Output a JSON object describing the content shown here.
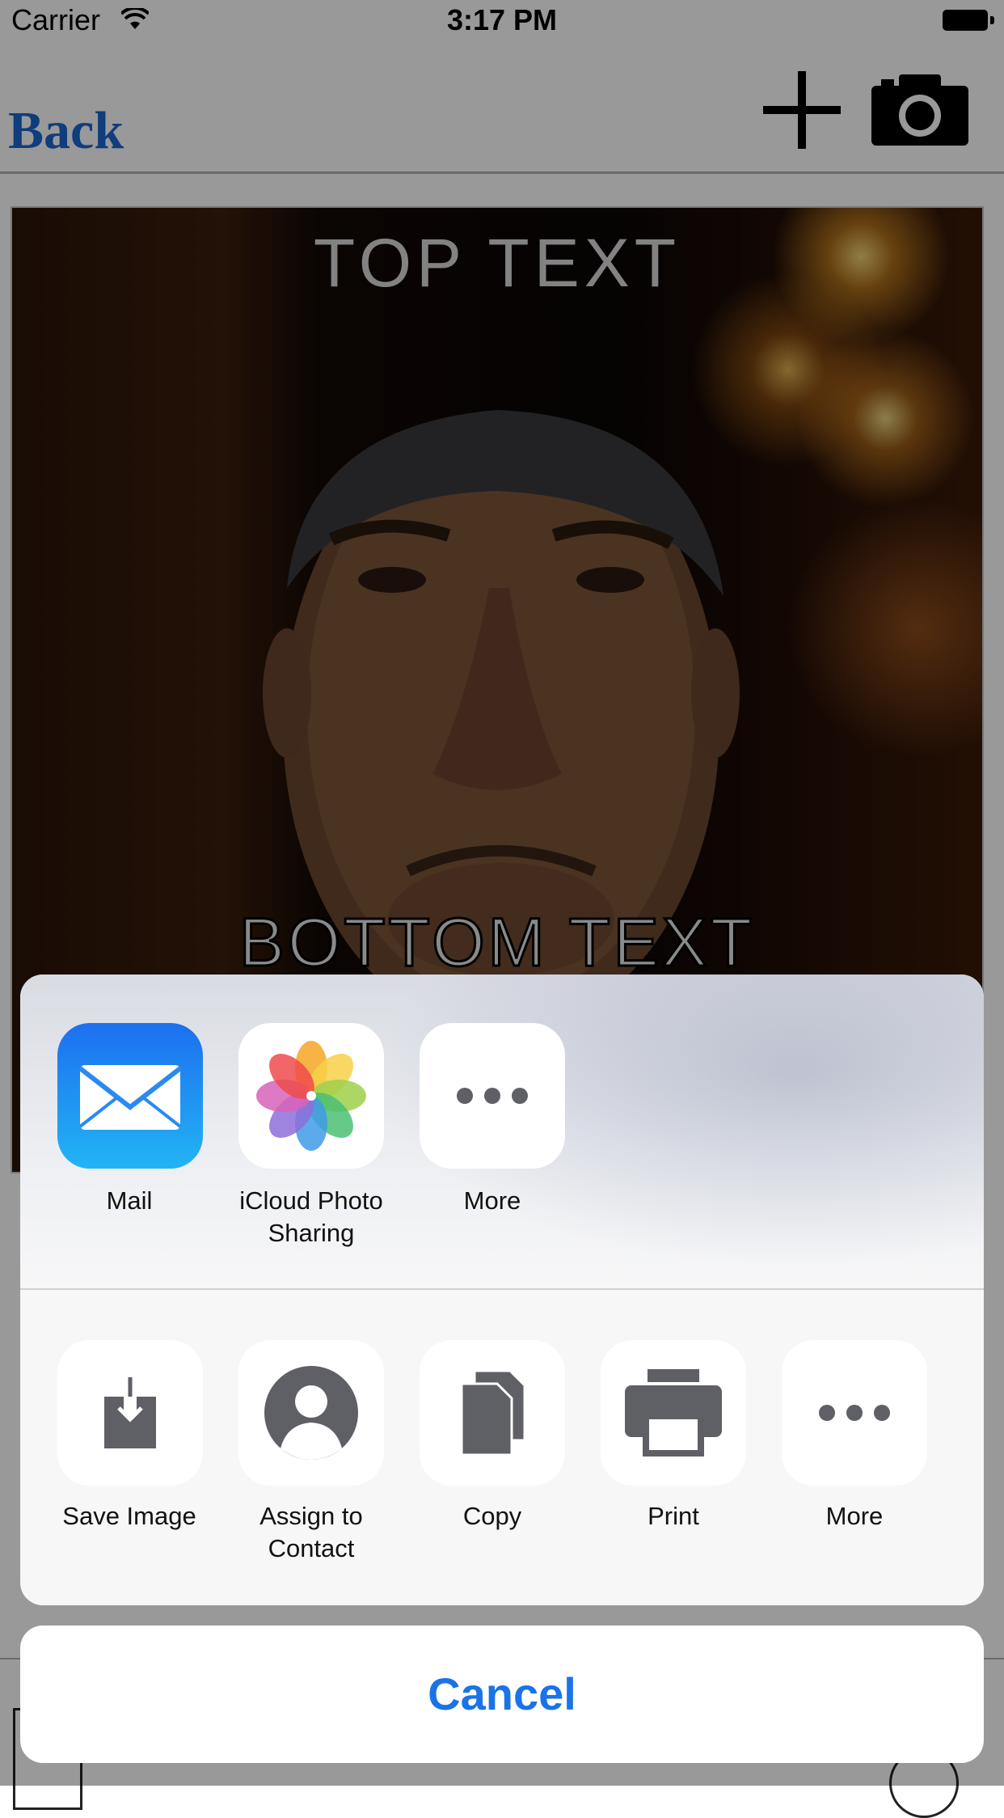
{
  "status_bar": {
    "carrier": "Carrier",
    "time": "3:17 PM"
  },
  "nav": {
    "back_label": "Back",
    "icons": [
      "plus-icon",
      "camera-icon"
    ]
  },
  "meme": {
    "top_text": "TOP TEXT",
    "bottom_text": "BOTTOM TEXT"
  },
  "share_sheet": {
    "app_row": [
      {
        "label": "Mail",
        "icon": "mail-icon"
      },
      {
        "label": "iCloud Photo Sharing",
        "icon": "photos-icon"
      },
      {
        "label": "More",
        "icon": "more-icon"
      }
    ],
    "action_row": [
      {
        "label": "Save Image",
        "icon": "save-image-icon"
      },
      {
        "label": "Assign to Contact",
        "icon": "contact-icon"
      },
      {
        "label": "Copy",
        "icon": "copy-icon"
      },
      {
        "label": "Print",
        "icon": "print-icon"
      },
      {
        "label": "More",
        "icon": "more-icon"
      }
    ],
    "cancel_label": "Cancel"
  },
  "colors": {
    "accent": "#1a73e8",
    "back_link": "#1a66d0",
    "icon_gray": "#5f5f66"
  }
}
